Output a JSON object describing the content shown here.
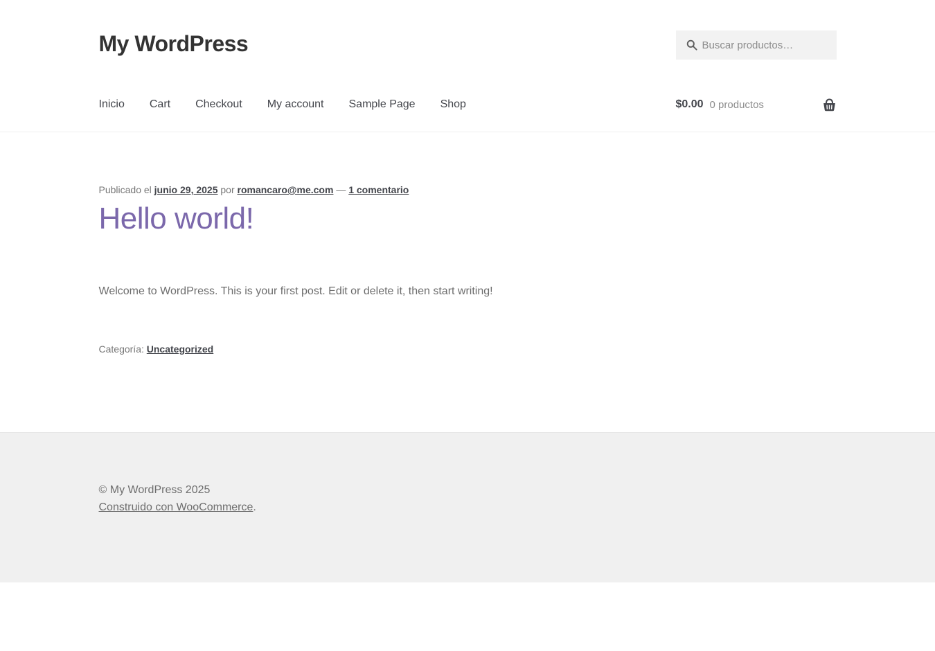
{
  "header": {
    "site_title": "My WordPress",
    "search": {
      "placeholder": "Buscar productos…"
    },
    "nav_items": [
      {
        "label": "Inicio"
      },
      {
        "label": "Cart"
      },
      {
        "label": "Checkout"
      },
      {
        "label": "My account"
      },
      {
        "label": "Sample Page"
      },
      {
        "label": "Shop"
      }
    ],
    "cart": {
      "total": "$0.00",
      "count": "0 productos"
    }
  },
  "post": {
    "meta": {
      "published_prefix": "Publicado el",
      "date": "junio 29, 2025",
      "by": "por",
      "author": "romancaro@me.com",
      "separator": "—",
      "comments": "1 comentario"
    },
    "title": "Hello world!",
    "body": "Welcome to WordPress. This is your first post. Edit or delete it, then start writing!",
    "category_label": "Categoría:",
    "category": "Uncategorized"
  },
  "footer": {
    "copyright": "© My WordPress 2025",
    "credit_link": "Construido con WooCommerce",
    "credit_suffix": "."
  },
  "icons": {
    "search": "magnifier-icon",
    "basket": "shopping-basket-icon"
  },
  "colors": {
    "accent": "#7b68ab",
    "heading": "#333333",
    "dark_text": "#43454b",
    "body_text": "#6d6d6d",
    "muted_text": "#8d8d8d",
    "search_bg": "#f2f2f2",
    "footer_bg": "#f0f0f0"
  }
}
